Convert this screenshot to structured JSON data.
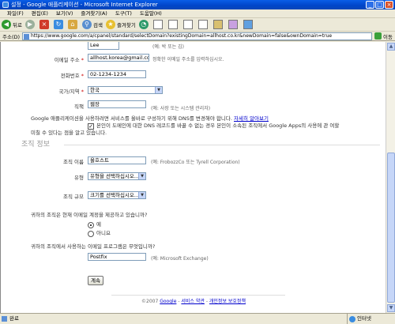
{
  "window": {
    "title": "설정 - Google 애플리케이션 - Microsoft Internet Explorer"
  },
  "menu": [
    "파일(F)",
    "편집(E)",
    "보기(V)",
    "즐겨찾기(A)",
    "도구(T)",
    "도움말(H)"
  ],
  "toolbar": {
    "back": "뒤로",
    "search": "검색",
    "favorites": "즐겨찾기"
  },
  "address": {
    "label": "주소(D)",
    "url": "https://www.google.com/a/cpanel/standard/selectDomain?existingDomain=allhost.co.kr&newDomain=false&ownDomain=true",
    "go": "이동"
  },
  "form": {
    "name_last_value": "Lee",
    "name_hint": "(예: 박 또는 김)",
    "email_label": "이메일 주소",
    "email_value": "allhost.korea@gmail.com",
    "email_hint": "정확한 이메일 주소를 입력하십시오.",
    "phone_label": "전화번호",
    "phone_value": "02-1234-1234",
    "country_label": "국가/지역",
    "country_value": "한국",
    "title_label": "직책",
    "title_value": "웹장",
    "title_hint": "(예: 사장 또는 시스템 관리자)",
    "required_mark": "*",
    "notice_text": "Google 애플리케이션을 사용하려면 서비스를 올바로 구성하기 위해 DNS를 변경해야 합니다.",
    "notice_link": "자세히 알아보기",
    "agree_text": "본인이 도메인에 대한 DNS 레코드를 바꿀 수 없는 경우 본인이 소속된 조직에서 Google Apps의 사용에 관 여할",
    "agree_text2": "미칠 수 있다는 점을 알고 있습니다.",
    "org_section": "조직 정보",
    "org_name_label": "조직 이름",
    "org_name_value": "올호스트",
    "org_name_hint": "(예: FrobozzCo 또는 Tyrell Corporation)",
    "type_label": "유형",
    "type_value": "유형을 선택하십시오...",
    "size_label": "조직 규모",
    "size_value": "크기를 선택하십시오...",
    "q1": "귀하의 조직은 현재 이메일 계정을 제공하고 있습니까?",
    "q1_yes": "예",
    "q1_no": "아니요",
    "q2": "귀하의 조직에서 사용하는 이메일 프로그램은 무엇입니까?",
    "q2_value": "Postfix",
    "q2_hint": "(예: Microsoft Exchange)",
    "continue": "계속"
  },
  "footer": {
    "copyright": "©2007",
    "google": "Google",
    "sep1": " - ",
    "terms": "서비스 약관",
    "sep2": " - ",
    "privacy": "개인정보 보호정책"
  },
  "status": {
    "text": "완료",
    "zone": "인터넷"
  }
}
